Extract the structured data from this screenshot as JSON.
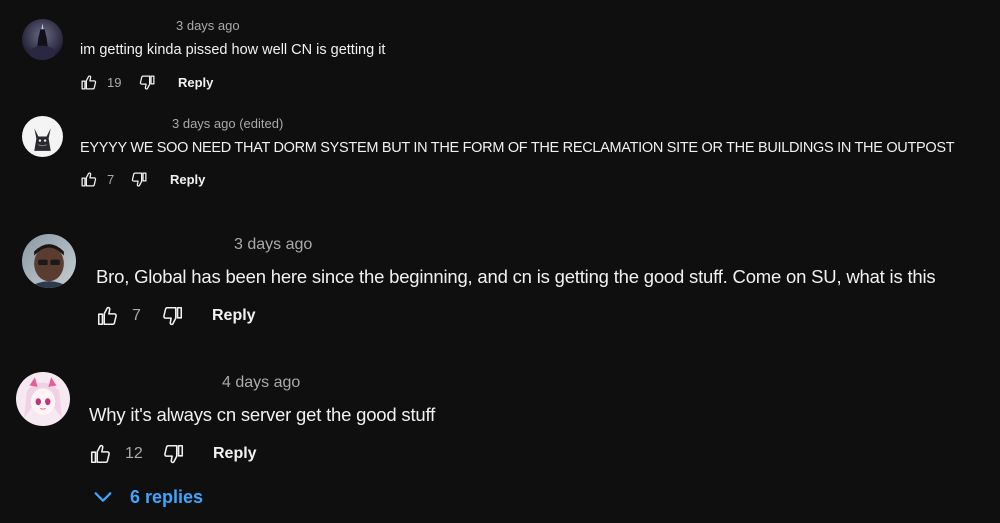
{
  "comments": [
    {
      "timestamp": "3 days ago",
      "text": "im getting kinda pissed how well CN is getting it",
      "likes": "19",
      "reply_label": "Reply",
      "avatar_icon": "dark-character-avatar"
    },
    {
      "timestamp": "3 days ago (edited)",
      "text": "EYYYY WE SOO NEED THAT DORM SYSTEM BUT IN THE FORM OF THE RECLAMATION SITE OR THE BUILDINGS IN THE OUTPOST",
      "likes": "7",
      "reply_label": "Reply",
      "avatar_icon": "wolf-character-avatar"
    },
    {
      "timestamp": "3 days ago",
      "text": "Bro, Global has been here since the beginning, and cn is getting the good stuff. Come on SU, what is this",
      "likes": "7",
      "reply_label": "Reply",
      "avatar_icon": "person-photo-avatar"
    },
    {
      "timestamp": "4 days ago",
      "text": "Why it's always cn server get the good stuff",
      "likes": "12",
      "reply_label": "Reply",
      "avatar_icon": "anime-girl-avatar",
      "replies_label": "6 replies"
    }
  ],
  "colors": {
    "background": "#0f0f0f",
    "text": "#f1f1f1",
    "secondary_text": "#aaaaaa",
    "link": "#3ea6ff"
  }
}
